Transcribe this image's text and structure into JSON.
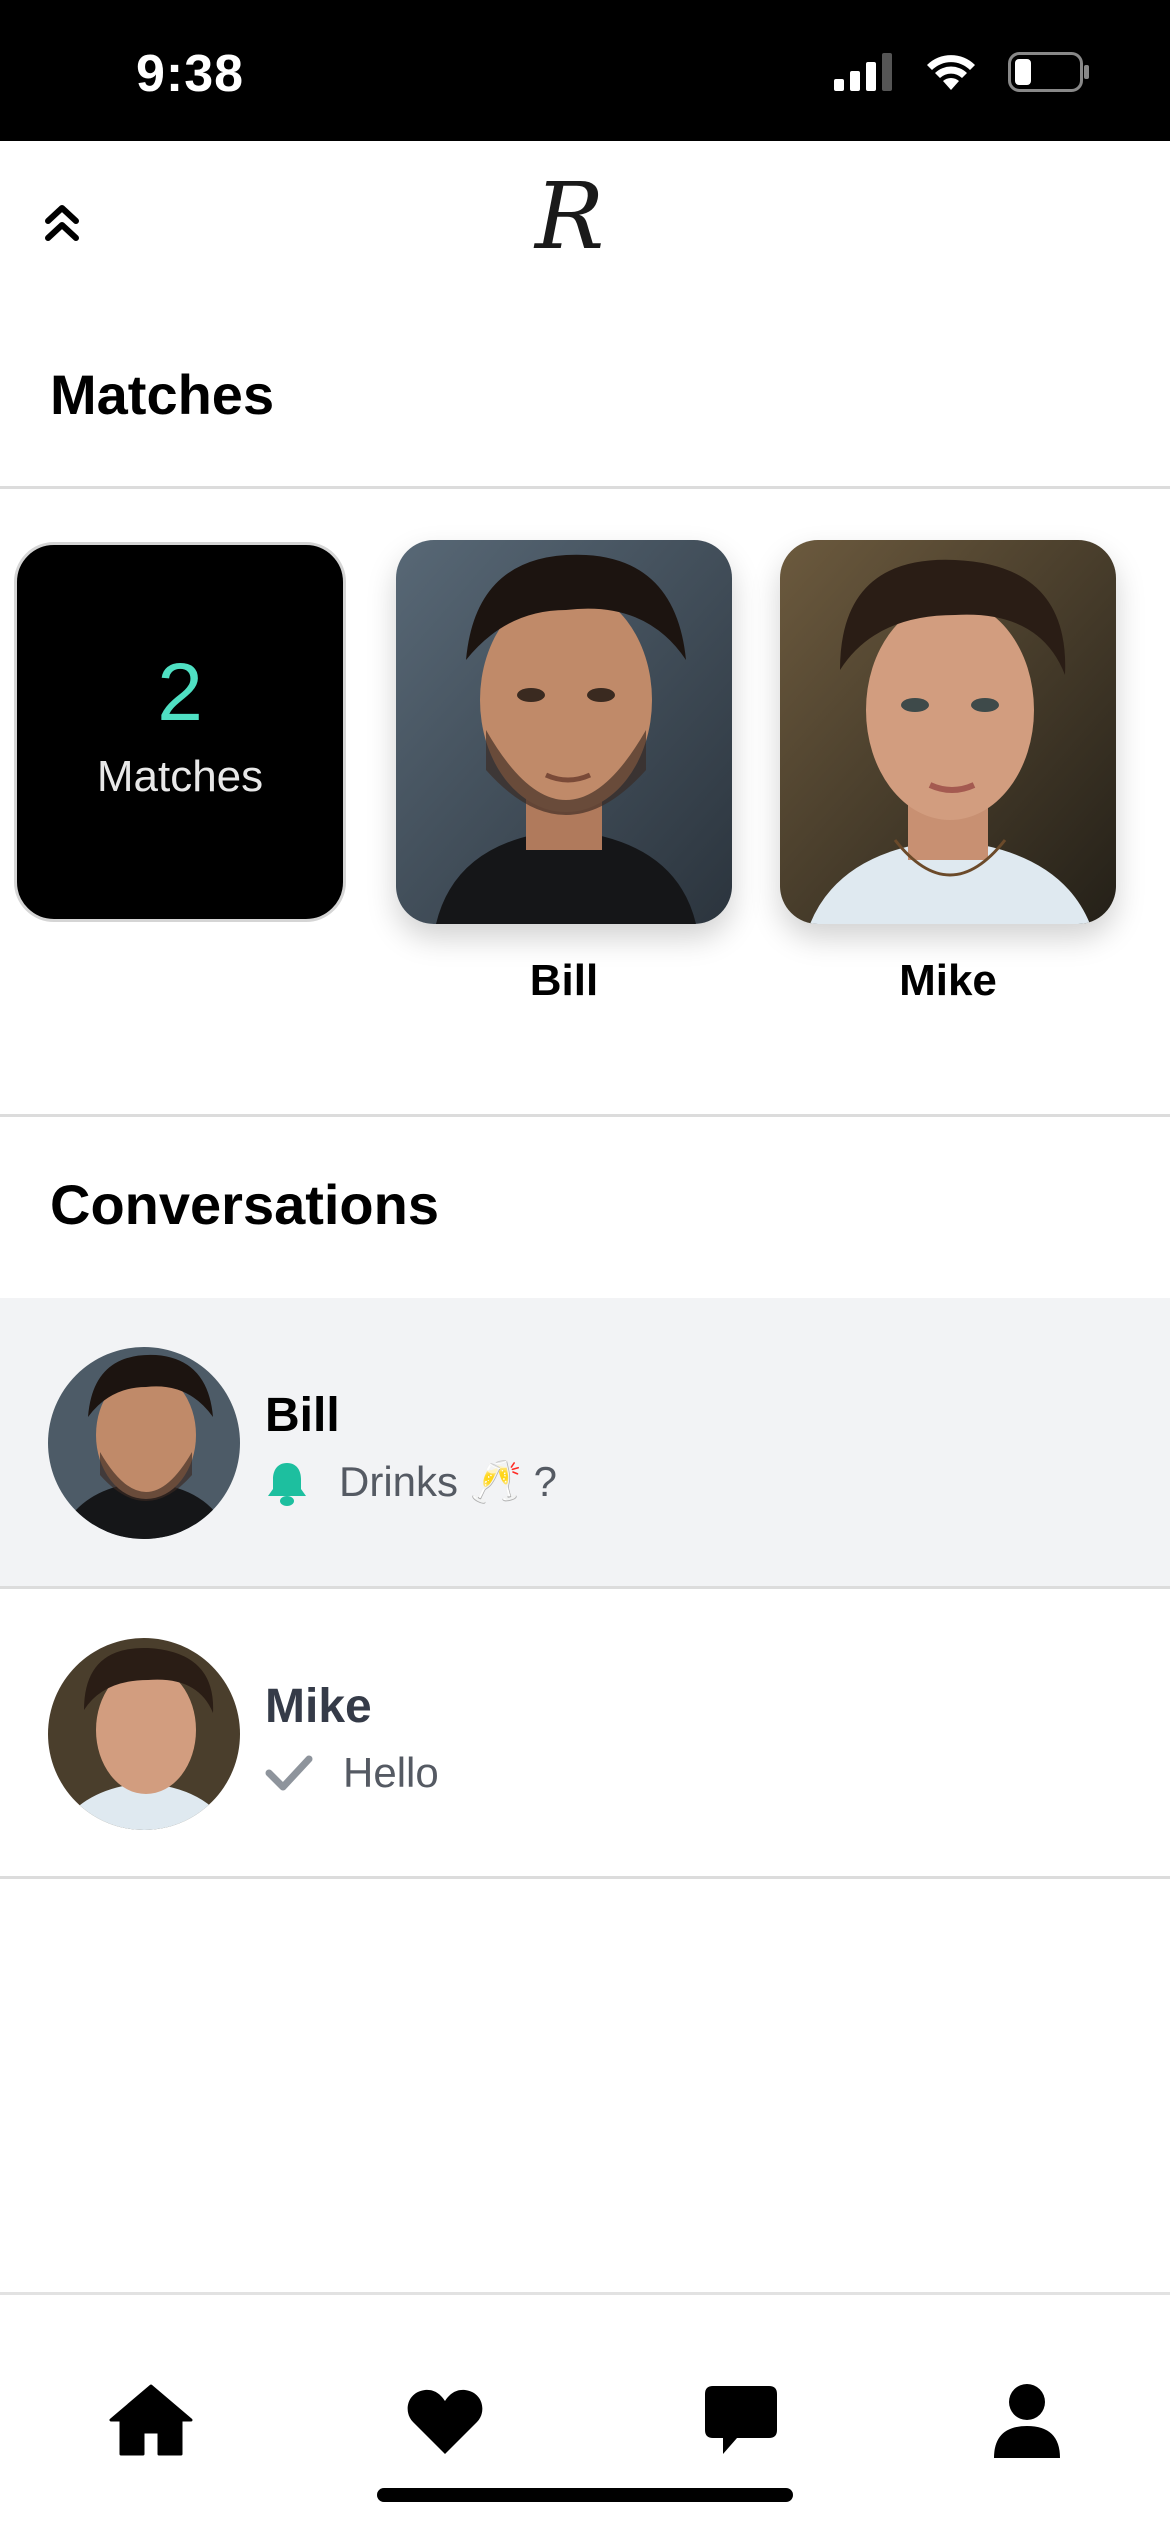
{
  "status_bar": {
    "time": "9:38"
  },
  "header": {
    "logo_text": "R"
  },
  "matches": {
    "title": "Matches",
    "count": "2",
    "count_label": "Matches",
    "cards": [
      {
        "name": "Bill"
      },
      {
        "name": "Mike"
      }
    ]
  },
  "conversations": {
    "title": "Conversations",
    "items": [
      {
        "name": "Bill",
        "message": "Drinks 🥂 ?",
        "status_icon": "bell-icon",
        "status_color": "#1dbf9f",
        "highlighted": true
      },
      {
        "name": "Mike",
        "message": "Hello",
        "status_icon": "check-icon",
        "status_color": "#8e949c",
        "highlighted": false
      }
    ]
  },
  "tabs": [
    {
      "icon": "home-icon"
    },
    {
      "icon": "heart-icon"
    },
    {
      "icon": "chat-icon"
    },
    {
      "icon": "profile-icon"
    }
  ],
  "colors": {
    "accent": "#4fe0c3",
    "bell": "#1dbf9f"
  }
}
